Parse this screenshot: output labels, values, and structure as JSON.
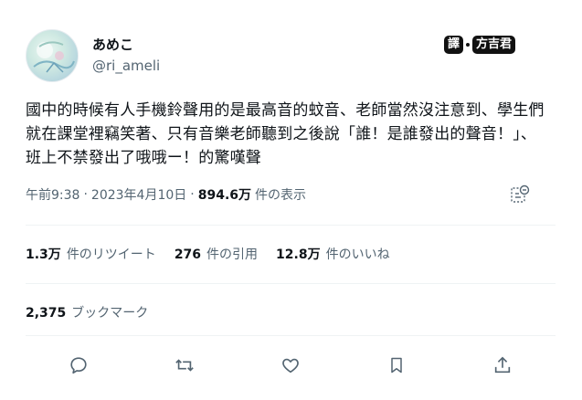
{
  "author": {
    "display_name": "あめこ",
    "handle": "@ri_ameli"
  },
  "translator_badge": {
    "part1": "譯",
    "part2": "方吉君"
  },
  "tweet": {
    "text": "國中的時候有人手機鈴聲用的是最高音的蚊音、老師當然沒注意到、學生們就在課堂裡竊笑著、只有音樂老師聽到之後說「誰！是誰發出的聲音！」、班上不禁發出了哦哦ー！的驚嘆聲"
  },
  "meta": {
    "time": "午前9:38",
    "separator1": "·",
    "date": "2023年4月10日",
    "separator2": "·",
    "views_count": "894.6万",
    "views_label": "件の表示"
  },
  "stats": {
    "retweets_count": "1.3万",
    "retweets_label": "件のリツイート",
    "quotes_count": "276",
    "quotes_label": "件の引用",
    "likes_count": "12.8万",
    "likes_label": "件のいいね"
  },
  "bookmarks": {
    "count": "2,375",
    "label": "ブックマーク"
  },
  "icons": {
    "analytics": "analytics-icon",
    "reply": "reply-icon",
    "retweet": "retweet-icon",
    "like": "like-icon",
    "bookmark": "bookmark-icon",
    "share": "share-icon"
  },
  "colors": {
    "text": "#0f1419",
    "secondary": "#536471",
    "divider": "#eff3f4"
  }
}
